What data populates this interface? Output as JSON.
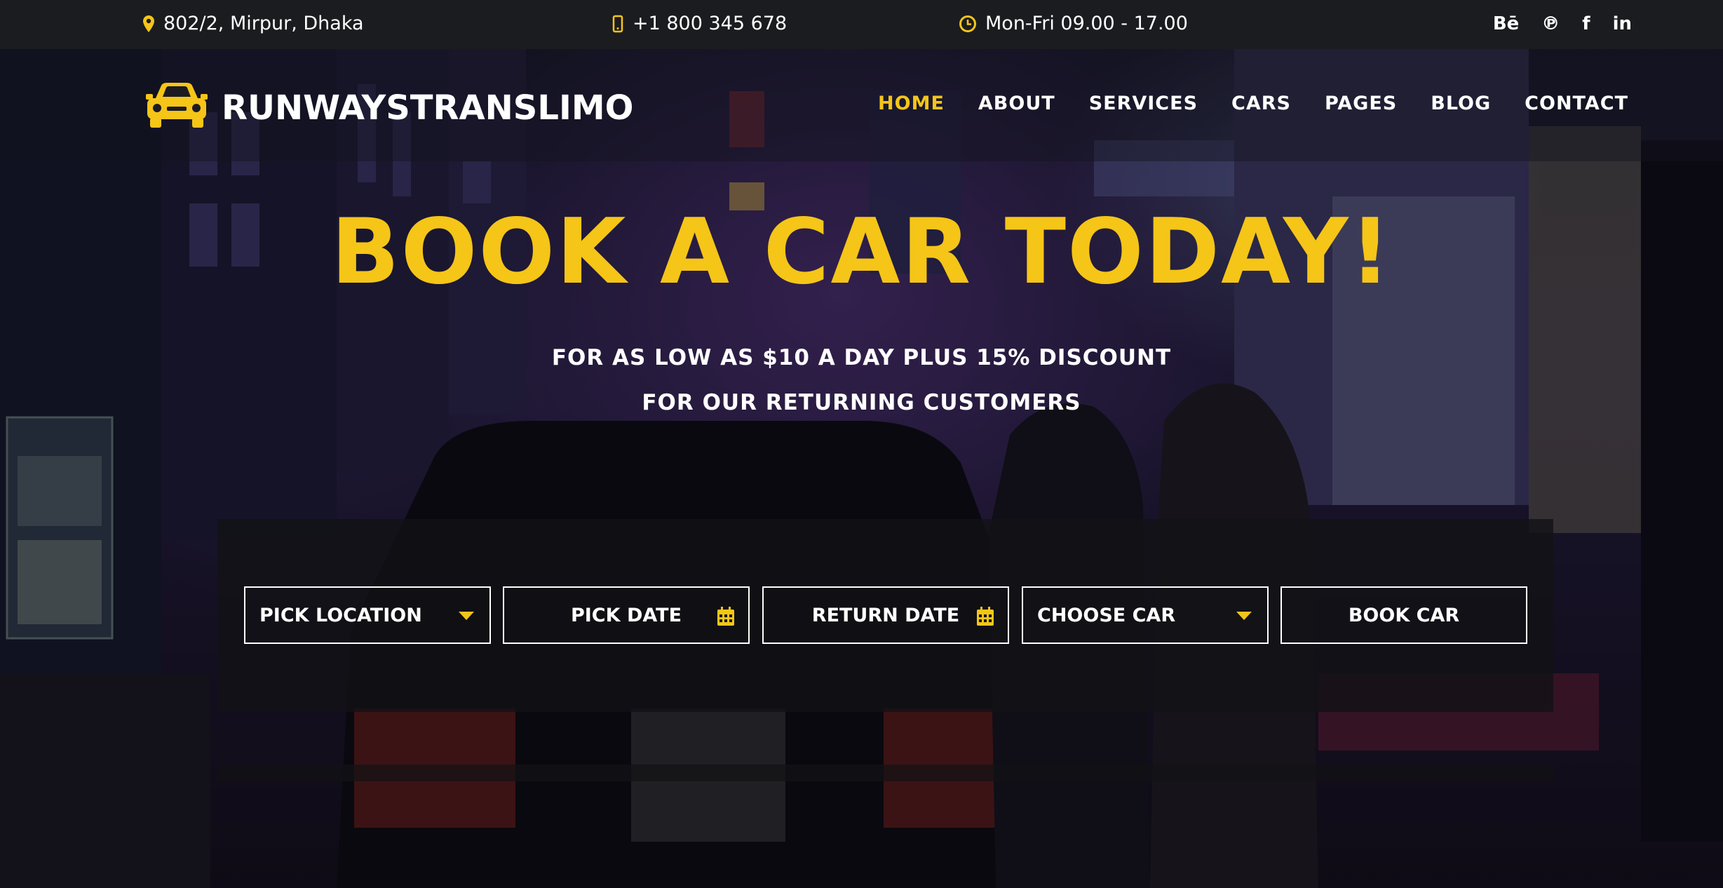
{
  "topbar": {
    "address": "802/2, Mirpur, Dhaka",
    "phone": "+1 800 345 678",
    "hours": "Mon-Fri 09.00 - 17.00",
    "social": [
      {
        "icon": "behance-icon",
        "glyph": "Bē"
      },
      {
        "icon": "pinterest-icon",
        "glyph": "℗"
      },
      {
        "icon": "facebook-icon",
        "glyph": "f"
      },
      {
        "icon": "linkedin-icon",
        "glyph": "in"
      }
    ]
  },
  "brand": {
    "logo_text": "RUNWAYSTRANSLIMO",
    "logo_icon": "car-icon",
    "accent_color": "#f5c518"
  },
  "nav": {
    "items": [
      "HOME",
      "ABOUT",
      "SERVICES",
      "CARS",
      "PAGES",
      "BLOG",
      "CONTACT"
    ],
    "active": "HOME"
  },
  "hero": {
    "title": "BOOK A CAR TODAY!",
    "subtitle_line1": "FOR AS LOW AS $10 A DAY PLUS 15% DISCOUNT",
    "subtitle_line2": "FOR OUR RETURNING CUSTOMERS"
  },
  "booking": {
    "pick_location": "PICK LOCATION",
    "pick_date": "PICK DATE",
    "return_date": "RETURN DATE",
    "choose_car": "CHOOSE CAR",
    "book_car": "BOOK CAR"
  }
}
